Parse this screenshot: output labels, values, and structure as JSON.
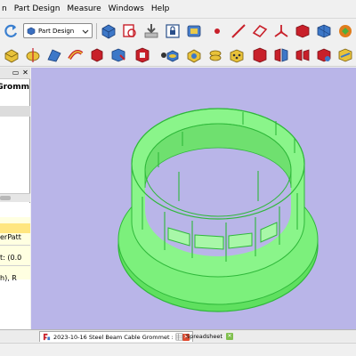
{
  "menubar": {
    "items": [
      "n",
      "Part Design",
      "Measure",
      "Windows",
      "Help"
    ]
  },
  "workbench_selector": {
    "value": "Part Design"
  },
  "left_panel": {
    "title": "Gromm",
    "rows": [
      "erPatt",
      "t: (0.0",
      "h), R"
    ]
  },
  "tabs": [
    {
      "label": "2023-10-16 Steel Beam Cable Grommet : 1"
    },
    {
      "label": "Spreadsheet"
    }
  ],
  "icons": {
    "toolbar1": [
      "refresh-icon",
      "workbench-icon",
      "dropdown-chevron-icon",
      "body-icon",
      "sketch-attach-icon",
      "import-icon",
      "lock-icon",
      "macro-icon",
      "point-icon",
      "line-icon",
      "plane-icon",
      "coordinate-system-icon",
      "shape-binder-icon",
      "clone-icon",
      "sub-shape-icon"
    ],
    "toolbar2": [
      "pad-icon",
      "revolution-icon",
      "additive-loft-icon",
      "additive-pipe-icon",
      "additive-helix-icon",
      "additive-primitive-icon",
      "pocket-icon",
      "hole-icon",
      "groove-icon",
      "subtractive-loft-icon",
      "subtractive-pipe-icon",
      "subtractive-helix-icon",
      "subtractive-primitive-icon",
      "mirror-icon",
      "linear-pattern-icon",
      "polar-pattern-icon",
      "multi-transform-icon",
      "fillet-icon"
    ]
  },
  "colors": {
    "view_background": "#b9b5e8",
    "part_face": "#7cf07c",
    "part_edge": "#2fb83a",
    "selection_highlight": "#ffe680",
    "property_background": "#ffffe1"
  }
}
